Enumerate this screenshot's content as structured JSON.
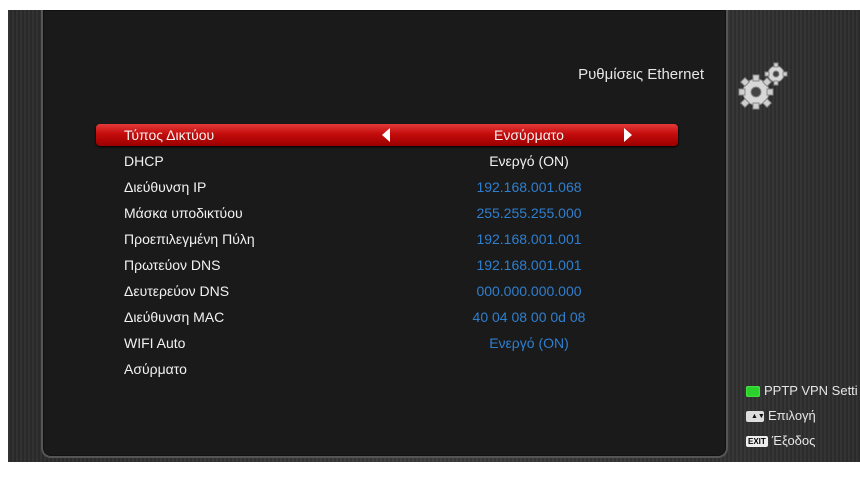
{
  "header": {
    "title": "Ρυθμίσεις Ethernet",
    "icon": "gears-icon"
  },
  "settings": [
    {
      "label": "Τύπος Δικτύου",
      "value": "Ενσύρματο",
      "selected": true
    },
    {
      "label": "DHCP",
      "value": "Ενεργό (ON)"
    },
    {
      "label": "Διεύθυνση IP",
      "value": "192.168.001.068"
    },
    {
      "label": "Μάσκα υποδικτύου",
      "value": "255.255.255.000"
    },
    {
      "label": "Προεπιλεγμένη Πύλη",
      "value": "192.168.001.001"
    },
    {
      "label": "Πρωτεύον DNS",
      "value": "192.168.001.001"
    },
    {
      "label": "Δευτερεύον DNS",
      "value": "000.000.000.000"
    },
    {
      "label": "Διεύθυνση MAC",
      "value": "40 04 08 00 0d 08"
    },
    {
      "label": "WIFI Auto",
      "value": "Ενεργό (ON)"
    },
    {
      "label": "Ασύρματο",
      "value": ""
    }
  ],
  "legend": [
    {
      "key": "green-key",
      "label": "PPTP VPN Setti"
    },
    {
      "key": "nav-key",
      "label": "Επιλογή"
    },
    {
      "key": "exit-key",
      "key_text": "EXIT",
      "label": "Έξοδος"
    }
  ],
  "colors": {
    "highlight": "#c40c0c",
    "value_blue": "#2f7fcf",
    "green_key": "#2bd12b"
  }
}
